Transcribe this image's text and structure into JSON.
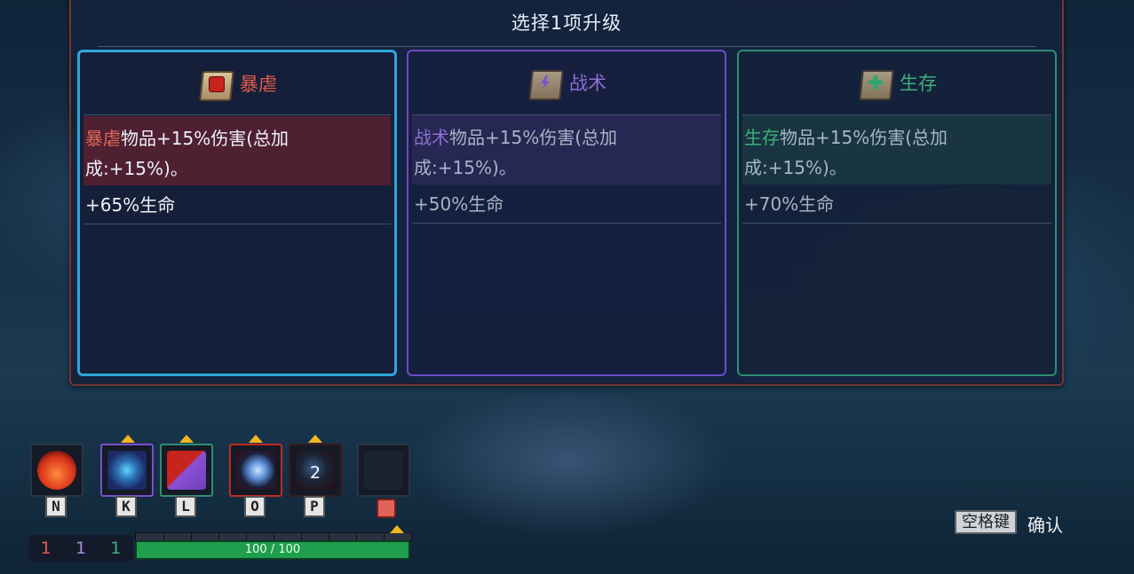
{
  "dialog": {
    "title": "选择1项升级"
  },
  "cards": [
    {
      "name": "暴虐",
      "keyword": "暴虐",
      "desc_rest": "物品+15%伤害(总加成:+15%)。",
      "stat": "+65%生命",
      "icon": "fist-scroll-icon",
      "color": "#e05a4e"
    },
    {
      "name": "战术",
      "keyword": "战术",
      "desc_rest": "物品+15%伤害(总加成:+15%)。",
      "stat": "+50%生命",
      "icon": "lightning-scroll-icon",
      "color": "#8c6fcf"
    },
    {
      "name": "生存",
      "keyword": "生存",
      "desc_rest": "物品+15%伤害(总加成:+15%)。",
      "stat": "+70%生命",
      "icon": "cross-scroll-icon",
      "color": "#3fae7c"
    }
  ],
  "hotbar": {
    "slots": [
      {
        "key": "N",
        "icon": "potion-icon"
      },
      {
        "key": "K",
        "icon": "whip-icon"
      },
      {
        "key": "L",
        "icon": "shield-icon"
      },
      {
        "key": "O",
        "icon": "orb-icon"
      },
      {
        "key": "P",
        "icon": "bomb-icon",
        "count": "2"
      },
      {
        "key": "",
        "icon": "empty-slot",
        "badge": "head-icon"
      }
    ],
    "counts": [
      {
        "value": "1",
        "color": "#e05a4e"
      },
      {
        "value": "1",
        "color": "#a98be0"
      },
      {
        "value": "1",
        "color": "#3fae7c"
      }
    ],
    "hp": {
      "current": 100,
      "max": 100,
      "text": "100 / 100"
    }
  },
  "confirm": {
    "key": "空格键",
    "label": "确认"
  }
}
